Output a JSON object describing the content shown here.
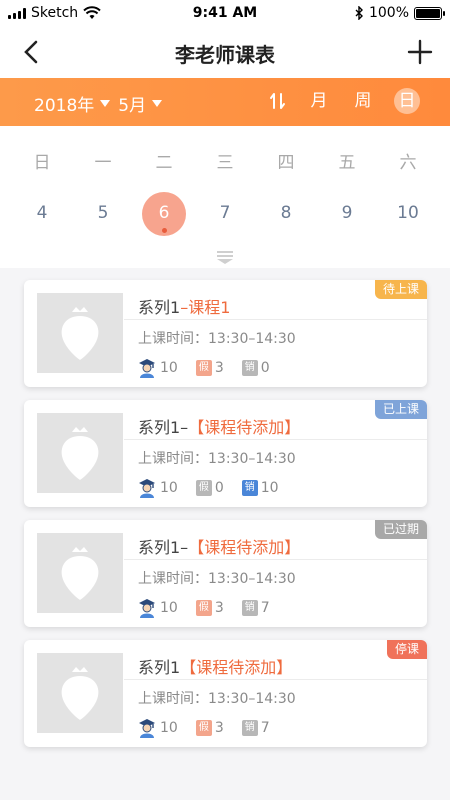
{
  "status_bar": {
    "carrier": "Sketch",
    "time": "9:41 AM",
    "battery": "100%",
    "battery_level": 1.0
  },
  "nav": {
    "title": "李老师课表"
  },
  "calendar_header": {
    "year": "2018年",
    "month": "5月",
    "views": [
      "月",
      "周",
      "日"
    ],
    "active_view": "日"
  },
  "calendar": {
    "weekdays": [
      "日",
      "一",
      "二",
      "三",
      "四",
      "五",
      "六"
    ],
    "dates": [
      "4",
      "5",
      "6",
      "7",
      "8",
      "9",
      "10"
    ],
    "selected": "6"
  },
  "courses": [
    {
      "title_prefix": "系列1",
      "title_highlight": "–课程1",
      "time_label": "上课时间：",
      "time": "13:30–14:30",
      "students": "10",
      "leave_tag": "假",
      "leave": "3",
      "cancel_tag": "销",
      "cancel": "0",
      "status": "待上课",
      "status_color": "#f7b54c",
      "leave_tag_color": "#f3a58c",
      "cancel_tag_color": "#b7b7b7"
    },
    {
      "title_prefix": "系列1–",
      "title_highlight": "【课程待添加】",
      "time_label": "上课时间：",
      "time": "13:30–14:30",
      "students": "10",
      "leave_tag": "假",
      "leave": "0",
      "cancel_tag": "销",
      "cancel": "10",
      "status": "已上课",
      "status_color": "#7fa4d9",
      "leave_tag_color": "#b7b7b7",
      "cancel_tag_color": "#4a86d8"
    },
    {
      "title_prefix": "系列1–",
      "title_highlight": "【课程待添加】",
      "time_label": "上课时间：",
      "time": "13:30–14:30",
      "students": "10",
      "leave_tag": "假",
      "leave": "3",
      "cancel_tag": "销",
      "cancel": "7",
      "status": "已过期",
      "status_color": "#a8a8a8",
      "leave_tag_color": "#f3a58c",
      "cancel_tag_color": "#b7b7b7"
    },
    {
      "title_prefix": "系列1",
      "title_highlight": "【课程待添加】",
      "time_label": "上课时间：",
      "time": "13:30–14:30",
      "students": "10",
      "leave_tag": "假",
      "leave": "3",
      "cancel_tag": "销",
      "cancel": "7",
      "status": "停课",
      "status_color": "#f0725a",
      "leave_tag_color": "#f3a58c",
      "cancel_tag_color": "#b7b7b7"
    }
  ],
  "colors": {
    "accent": "#ff8a3c",
    "selected_date": "#f7a48e",
    "highlight_text": "#ef6b3e"
  },
  "icons": [
    "wifi-icon",
    "bluetooth-icon",
    "back-icon",
    "add-icon",
    "sort-icon",
    "expand-icon",
    "student-icon",
    "placeholder-logo-icon"
  ]
}
